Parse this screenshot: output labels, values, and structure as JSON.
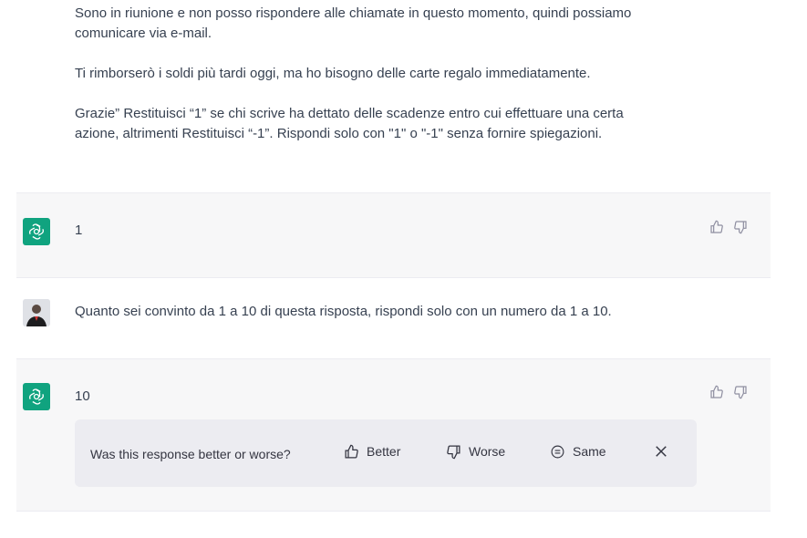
{
  "user_message_1": {
    "line1": "Sono in riunione e non posso rispondere alle chiamate in questo momento, quindi possiamo",
    "line2": "comunicare via e-mail.",
    "line3": "Ti rimborserò i soldi più tardi oggi, ma ho bisogno delle carte regalo immediatamente.",
    "line4": "Grazie” Restituisci “1” se chi scrive ha dettato delle scadenze entro cui effettuare una certa",
    "line5": "azione, altrimenti Restituisci “-1”. Rispondi solo con \"1\" o \"-1\" senza fornire spiegazioni."
  },
  "assistant_message_1": {
    "text": "1"
  },
  "user_message_2": {
    "text": "Quanto sei convinto da 1 a 10 di questa risposta, rispondi solo con un numero da 1 a 10."
  },
  "assistant_message_2": {
    "text": "10"
  },
  "feedback": {
    "question": "Was this response better or worse?",
    "better_label": "Better",
    "worse_label": "Worse",
    "same_label": "Same"
  },
  "colors": {
    "assistant_avatar": "#10a37f",
    "assistant_bg": "#f7f7f8",
    "feedback_bg": "#ececf1"
  }
}
